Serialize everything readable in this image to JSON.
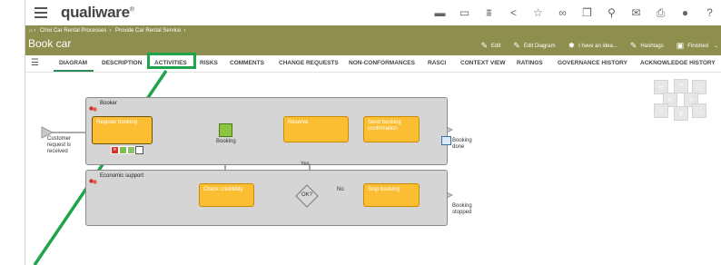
{
  "app": {
    "logo": "qualiware",
    "logo_mark": "®"
  },
  "topbar_icons": [
    "folder-icon",
    "monitor-icon",
    "graph-icon",
    "share-icon",
    "star-icon",
    "glasses-icon",
    "copy-icon",
    "search-icon",
    "mail-icon",
    "print-icon",
    "record-icon",
    "help-icon"
  ],
  "breadcrumb": [
    "Chixi Car Rental Processes",
    "Provide Car Rental Service"
  ],
  "page_title": "Book car",
  "actions": [
    {
      "label": "Edit",
      "icon": "pencil-icon"
    },
    {
      "label": "Edit Diagram",
      "icon": "pencil-icon"
    },
    {
      "label": "I have an idea...",
      "icon": "lightbulb-icon"
    },
    {
      "label": "Hashtags",
      "icon": "pencil-icon"
    },
    {
      "label": "Finished",
      "icon": "status-icon"
    }
  ],
  "tabs": [
    "DIAGRAM",
    "DESCRIPTION",
    "ACTIVITIES",
    "RISKS",
    "COMMENTS",
    "CHANGE REQUESTS",
    "NON-CONFORMANCES",
    "RASCI",
    "CONTEXT VIEW",
    "RATINGS",
    "GOVERNANCE HISTORY",
    "ACKNOWLEDGE HISTORY"
  ],
  "active_tab": "DIAGRAM",
  "highlighted_tab": "ACTIVITIES",
  "diagram": {
    "lanes": [
      "Booker",
      "Economic support"
    ],
    "activities": {
      "register": "Register booking",
      "reserve": "Reserve",
      "send": "Send booking confirmation",
      "check": "Check credibility",
      "stop": "Stop booking"
    },
    "events": {
      "start": "Customer request is received",
      "booking": "Booking",
      "done": "Booking done",
      "stopped": "Booking stopped"
    },
    "gateway": "OK?",
    "flow_labels": {
      "yes": "Yes",
      "no": "No"
    }
  },
  "colors": {
    "header": "#8e8e4f",
    "activity": "#fbbd32",
    "lane": "#d5d5d5",
    "highlight": "#1fa44a",
    "tab_underline": "#2e8b57"
  }
}
